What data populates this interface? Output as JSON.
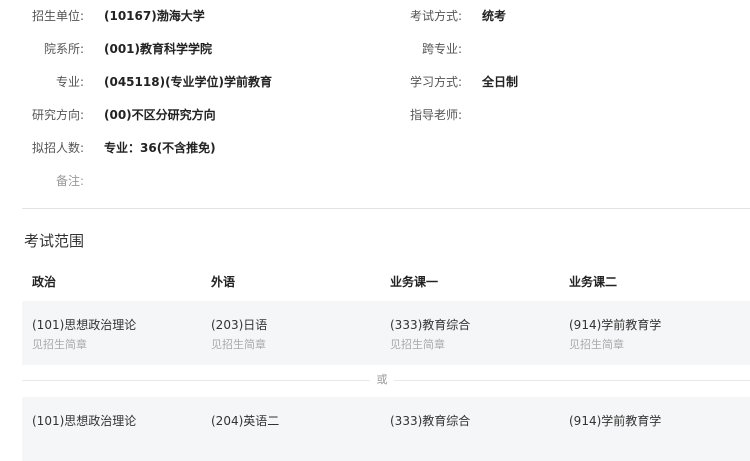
{
  "info": {
    "unit_label": "招生单位:",
    "unit_value": "(10167)渤海大学",
    "exam_mode_label": "考试方式:",
    "exam_mode_value": "统考",
    "dept_label": "院系所:",
    "dept_value": "(001)教育科学学院",
    "cross_label": "跨专业:",
    "major_label": "专业:",
    "major_value": "(045118)(专业学位)学前教育",
    "study_mode_label": "学习方式:",
    "study_mode_value": "全日制",
    "direction_label": "研究方向:",
    "direction_value": "(00)不区分研究方向",
    "advisor_label": "指导老师:",
    "quota_label": "拟招人数:",
    "quota_value": "专业：36(不含推免)",
    "remark_label": "备注:"
  },
  "exam": {
    "title": "考试范围",
    "headers": [
      "政治",
      "外语",
      "业务课一",
      "业务课二"
    ],
    "options": [
      {
        "cells": [
          {
            "name": "(101)思想政治理论",
            "note": "见招生简章"
          },
          {
            "name": "(203)日语",
            "note": "见招生简章"
          },
          {
            "name": "(333)教育综合",
            "note": "见招生简章"
          },
          {
            "name": "(914)学前教育学",
            "note": "见招生简章"
          }
        ]
      },
      {
        "cells": [
          {
            "name": "(101)思想政治理论",
            "note": ""
          },
          {
            "name": "(204)英语二",
            "note": ""
          },
          {
            "name": "(333)教育综合",
            "note": ""
          },
          {
            "name": "(914)学前教育学",
            "note": ""
          }
        ]
      }
    ],
    "or_text": "或"
  }
}
